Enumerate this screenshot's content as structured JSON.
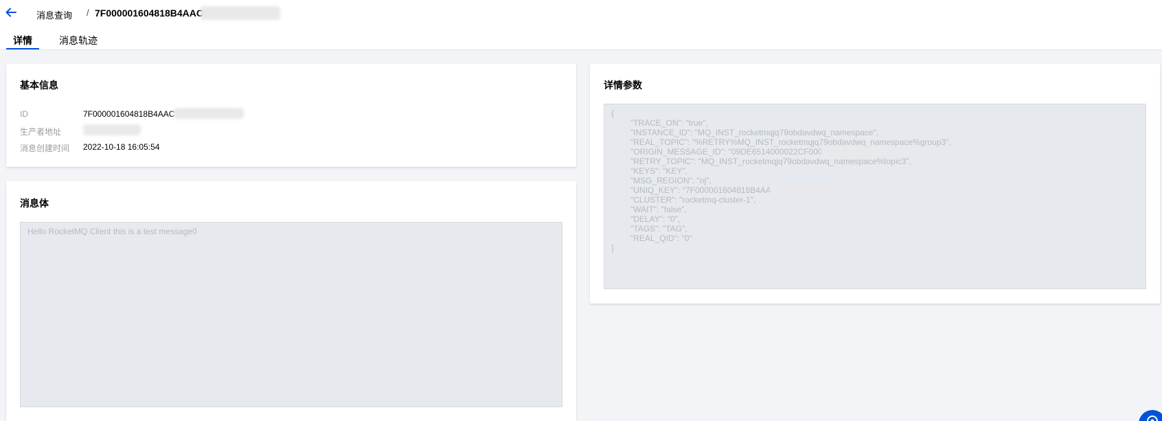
{
  "header": {
    "breadcrumb_parent": "消息查询",
    "breadcrumb_separator": "/",
    "breadcrumb_current": "7F000001604818B4AAC"
  },
  "tabs": [
    {
      "label": "详情",
      "active": true
    },
    {
      "label": "消息轨迹",
      "active": false
    }
  ],
  "basic_info": {
    "title": "基本信息",
    "rows": [
      {
        "label": "ID",
        "value": "7F000001604818B4AAC"
      },
      {
        "label": "生产者地址",
        "value": ""
      },
      {
        "label": "消息创建时间",
        "value": "2022-10-18 16:05:54"
      }
    ]
  },
  "message_body": {
    "title": "消息体",
    "content": "Hello RocketMQ Client this is a test message0"
  },
  "detail_params": {
    "title": "详情参数",
    "lines": [
      "{",
      "\"TRACE_ON\": \"true\",",
      "\"INSTANCE_ID\": \"MQ_INST_rocketmqjq79obdavdwq_namespace\",",
      "\"REAL_TOPIC\": \"%RETRY%MQ_INST_rocketmqjq79obdavdwq_namespace%group3\",",
      "\"ORIGIN_MESSAGE_ID\": \"09DE6514000022CF000",
      "\"RETRY_TOPIC\": \"MQ_INST_rocketmqjq79obdavdwq_namespace%topic3\",",
      "\"KEYS\": \"KEY\",",
      "\"MSG_REGION\": \"nj\",",
      "\"UNIQ_KEY\": \"7F000001604818B4AA",
      "\"CLUSTER\": \"rocketmq-cluster-1\",",
      "\"WAIT\": \"false\",",
      "\"DELAY\": \"0\",",
      "\"TAGS\": \"TAG\",",
      "\"REAL_QID\": \"0\"",
      "}"
    ]
  },
  "colors": {
    "accent": "#0052d9",
    "page_background": "#f3f4f7",
    "code_background": "#e6e9ee"
  },
  "icons": {
    "back": "arrow-left-icon",
    "help": "help-icon"
  }
}
